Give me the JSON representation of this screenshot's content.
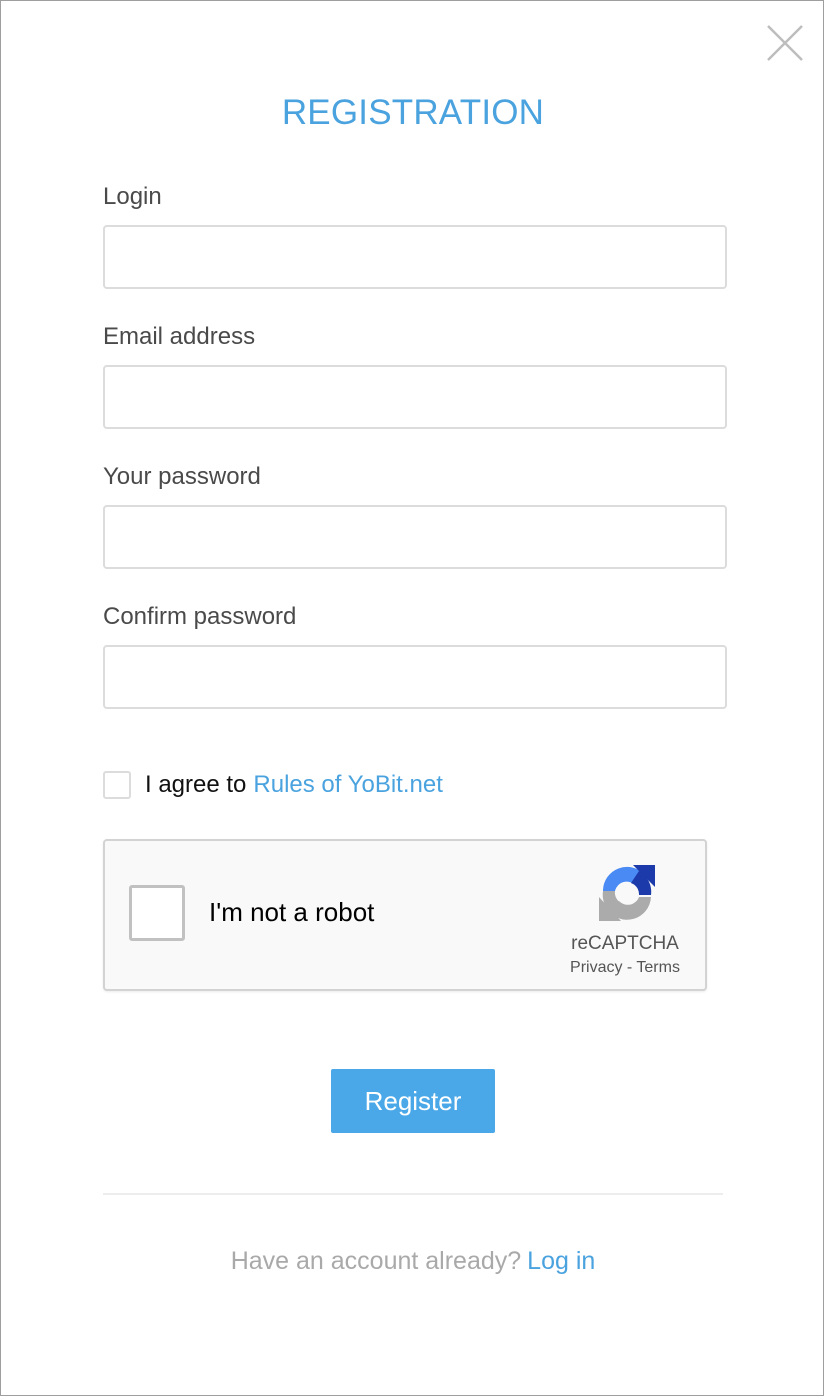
{
  "title": "REGISTRATION",
  "fields": {
    "login": {
      "label": "Login",
      "value": "",
      "placeholder": ""
    },
    "email": {
      "label": "Email address",
      "value": "",
      "placeholder": ""
    },
    "password": {
      "label": "Your password",
      "value": "",
      "placeholder": ""
    },
    "confirm": {
      "label": "Confirm password",
      "value": "",
      "placeholder": ""
    }
  },
  "agree": {
    "text": "I agree to",
    "link": "Rules of YoBit.net",
    "checked": false
  },
  "recaptcha": {
    "label": "I'm not a robot",
    "brand": "reCAPTCHA",
    "privacy": "Privacy",
    "separator": " - ",
    "terms": "Terms",
    "checked": false
  },
  "register_label": "Register",
  "footer": {
    "text": "Have an account already?",
    "link": "Log in"
  },
  "icons": {
    "close": "close-icon",
    "recaptcha_logo": "recaptcha-logo-icon"
  },
  "colors": {
    "accent": "#4aa3df",
    "button": "#4aa8e8",
    "muted_text": "#a9a9a9"
  }
}
